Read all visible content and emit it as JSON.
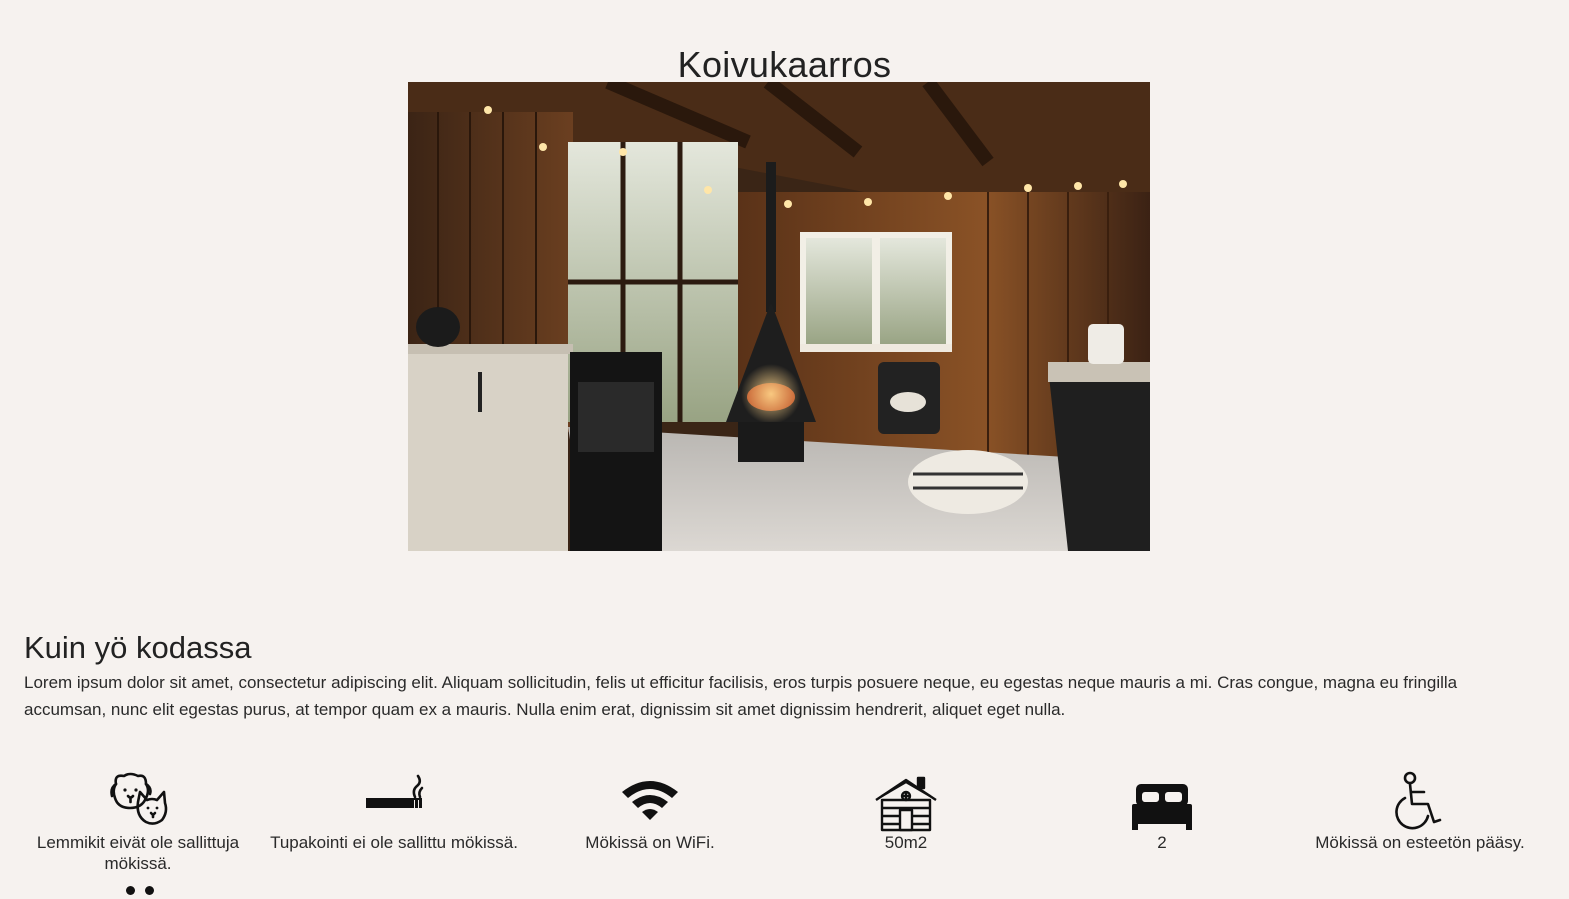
{
  "page": {
    "title": "Koivukaarros"
  },
  "hero": {
    "alt": "Cabin interior with fireplace",
    "accent": "#7a4a26"
  },
  "section": {
    "title": "Kuin yö kodassa",
    "description": "Lorem ipsum dolor sit amet, consectetur adipiscing elit. Aliquam sollicitudin, felis ut efficitur facilisis, eros turpis posuere neque, eu egestas neque mauris a mi. Cras congue, magna eu fringilla accumsan, nunc elit egestas purus, at tempor quam ex a mauris. Nulla enim erat, dignissim sit amet dignissim hendrerit, aliquet eget nulla."
  },
  "amenities": [
    {
      "icon": "pets-icon",
      "label": "Lemmikit eivät ole sallittuja mökissä."
    },
    {
      "icon": "smoking-icon",
      "label": "Tupakointi ei ole sallittu mökissä."
    },
    {
      "icon": "wifi-icon",
      "label": "Mökissä on WiFi."
    },
    {
      "icon": "cabin-icon",
      "label": "50m2"
    },
    {
      "icon": "bed-icon",
      "label": "2"
    },
    {
      "icon": "wheelchair-icon",
      "label": "Mökissä on esteetön pääsy."
    }
  ],
  "carousel": {
    "dot_count": 2
  }
}
